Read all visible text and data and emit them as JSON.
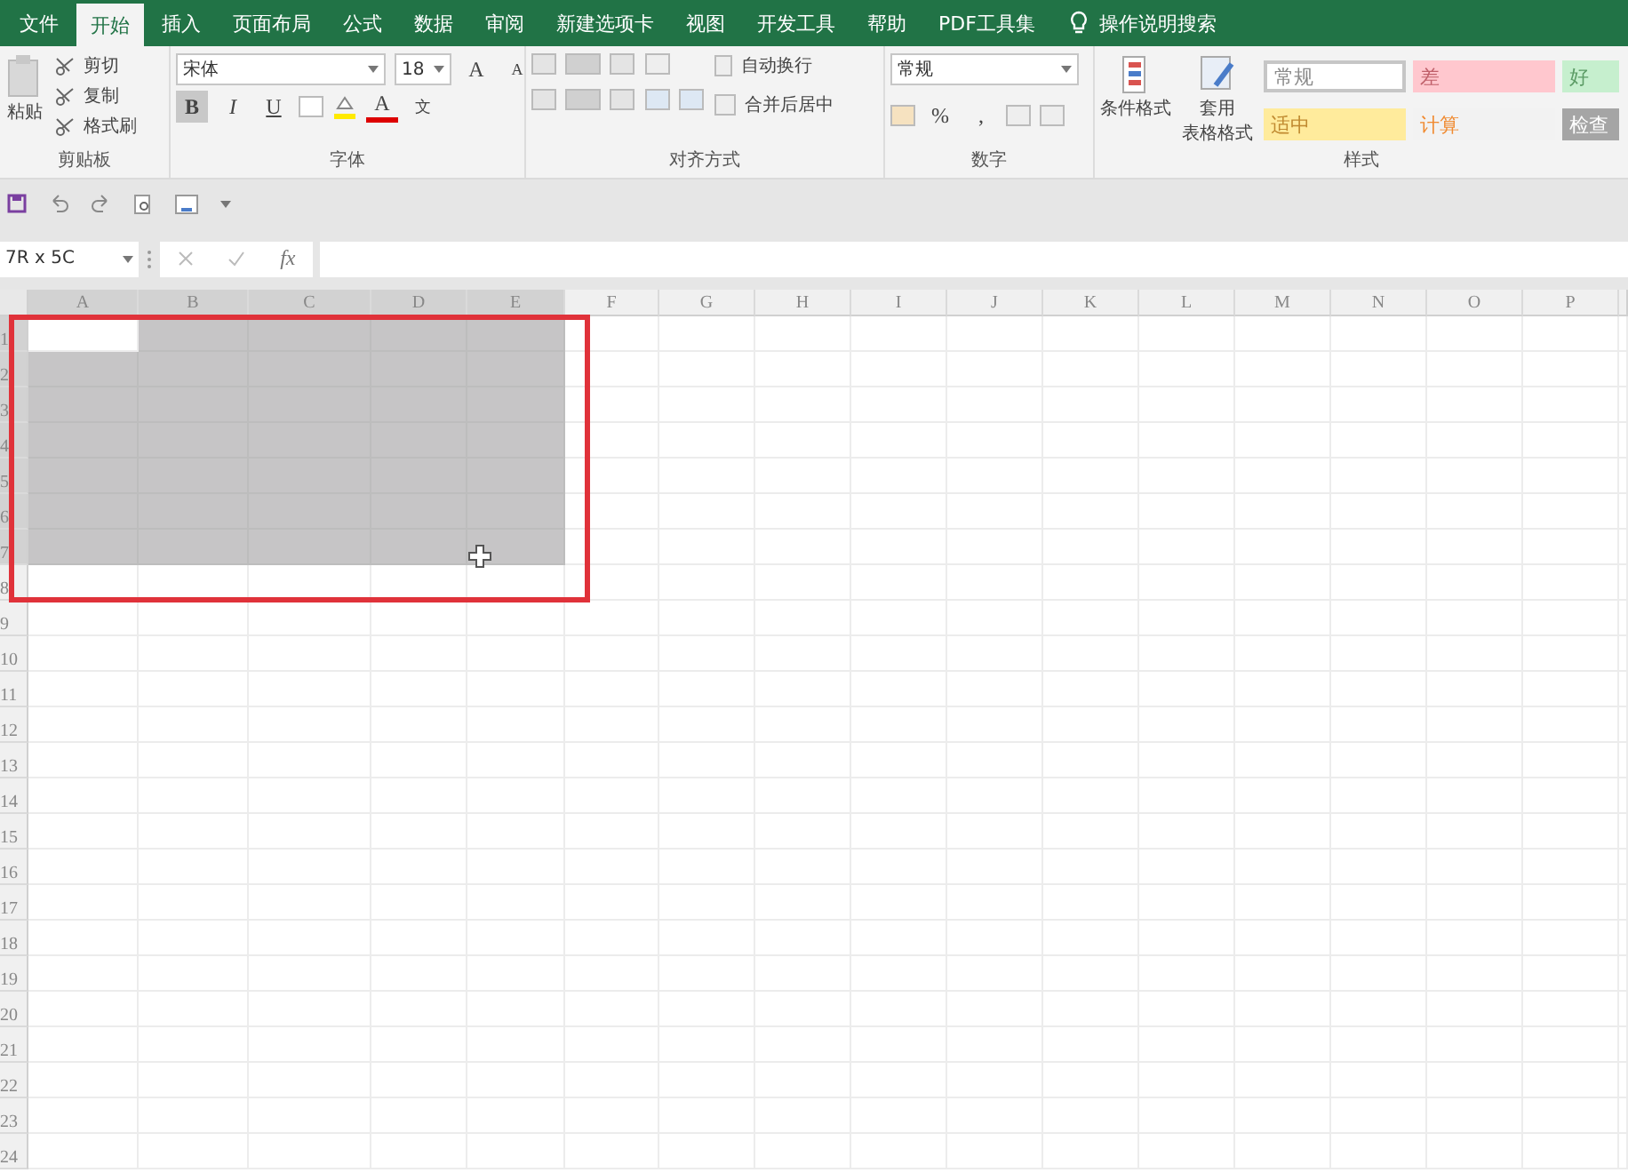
{
  "menu_tabs": [
    {
      "label": "文件",
      "selected": false
    },
    {
      "label": "开始",
      "selected": true
    },
    {
      "label": "插入",
      "selected": false
    },
    {
      "label": "页面布局",
      "selected": false
    },
    {
      "label": "公式",
      "selected": false
    },
    {
      "label": "数据",
      "selected": false
    },
    {
      "label": "审阅",
      "selected": false
    },
    {
      "label": "新建选项卡",
      "selected": false
    },
    {
      "label": "视图",
      "selected": false
    },
    {
      "label": "开发工具",
      "selected": false
    },
    {
      "label": "帮助",
      "selected": false
    },
    {
      "label": "PDF工具集",
      "selected": false
    }
  ],
  "search": {
    "label": "操作说明搜索"
  },
  "ribbon": {
    "clipboard": {
      "paste": "粘贴",
      "items": [
        "剪切",
        "复制",
        "格式刷"
      ],
      "label": "剪贴板"
    },
    "font": {
      "name": "宋体",
      "size": "18",
      "grow": "A",
      "shrink": "A",
      "format_buttons": [
        "B",
        "I",
        "U"
      ],
      "bold_on": true,
      "font_color": "A",
      "wen": "文",
      "label": "字体"
    },
    "alignment": {
      "wrap": "自动换行",
      "merge": "合并后居中",
      "label": "对齐方式"
    },
    "number": {
      "format": "常规",
      "percent": "%",
      "comma": ",",
      "label": "数字"
    },
    "styles": {
      "conditional": "条件格式",
      "table": [
        "套用",
        "表格格式"
      ],
      "cells": [
        {
          "label": "常规",
          "color": "#ffffff",
          "kind": "normal"
        },
        {
          "label": "差",
          "color": "#ffc7ce",
          "kind": "bad"
        },
        {
          "label": "好",
          "color": "#c6efce",
          "kind": "good"
        },
        {
          "label": "适中",
          "color": "#ffeb9c",
          "kind": "neutral"
        },
        {
          "label": "计算",
          "color": "#f2f2f2",
          "kind": "calc"
        },
        {
          "label": "检查",
          "color": "#a5a5a5",
          "kind": "check"
        }
      ],
      "label": "样式"
    }
  },
  "name_box": "7R x 5C",
  "fx": "fx",
  "grid": {
    "columns": [
      {
        "label": "A",
        "selected": true,
        "active": true
      },
      {
        "label": "B",
        "selected": true,
        "active": false
      },
      {
        "label": "C",
        "selected": true,
        "active": false
      },
      {
        "label": "D",
        "selected": true,
        "active": false
      },
      {
        "label": "E",
        "selected": true,
        "active": false
      },
      {
        "label": "F",
        "selected": false,
        "active": false
      },
      {
        "label": "G",
        "selected": false,
        "active": false
      },
      {
        "label": "H",
        "selected": false,
        "active": false
      },
      {
        "label": "I",
        "selected": false,
        "active": false
      },
      {
        "label": "J",
        "selected": false,
        "active": false
      },
      {
        "label": "K",
        "selected": false,
        "active": false
      },
      {
        "label": "L",
        "selected": false,
        "active": false
      },
      {
        "label": "M",
        "selected": false,
        "active": false
      },
      {
        "label": "N",
        "selected": false,
        "active": false
      },
      {
        "label": "O",
        "selected": false,
        "active": false
      },
      {
        "label": "P",
        "selected": false,
        "active": false
      }
    ],
    "rows": [
      {
        "label": "1",
        "selected": true,
        "active": true
      },
      {
        "label": "2",
        "selected": true,
        "active": false
      },
      {
        "label": "3",
        "selected": true,
        "active": false
      },
      {
        "label": "4",
        "selected": true,
        "active": false
      },
      {
        "label": "5",
        "selected": true,
        "active": false
      },
      {
        "label": "6",
        "selected": true,
        "active": false
      },
      {
        "label": "7",
        "selected": true,
        "active": false
      },
      {
        "label": "8",
        "selected": false,
        "active": false
      },
      {
        "label": "9",
        "selected": false,
        "active": false
      },
      {
        "label": "10",
        "selected": false,
        "active": false
      },
      {
        "label": "11",
        "selected": false,
        "active": false
      },
      {
        "label": "12",
        "selected": false,
        "active": false
      },
      {
        "label": "13",
        "selected": false,
        "active": false
      },
      {
        "label": "14",
        "selected": false,
        "active": false
      },
      {
        "label": "15",
        "selected": false,
        "active": false
      },
      {
        "label": "16",
        "selected": false,
        "active": false
      },
      {
        "label": "17",
        "selected": false,
        "active": false
      },
      {
        "label": "18",
        "selected": false,
        "active": false
      },
      {
        "label": "19",
        "selected": false,
        "active": false
      },
      {
        "label": "20",
        "selected": false,
        "active": false
      },
      {
        "label": "21",
        "selected": false,
        "active": false
      },
      {
        "label": "22",
        "selected": false,
        "active": false
      },
      {
        "label": "23",
        "selected": false,
        "active": false
      },
      {
        "label": "24",
        "selected": false,
        "active": false
      }
    ]
  }
}
